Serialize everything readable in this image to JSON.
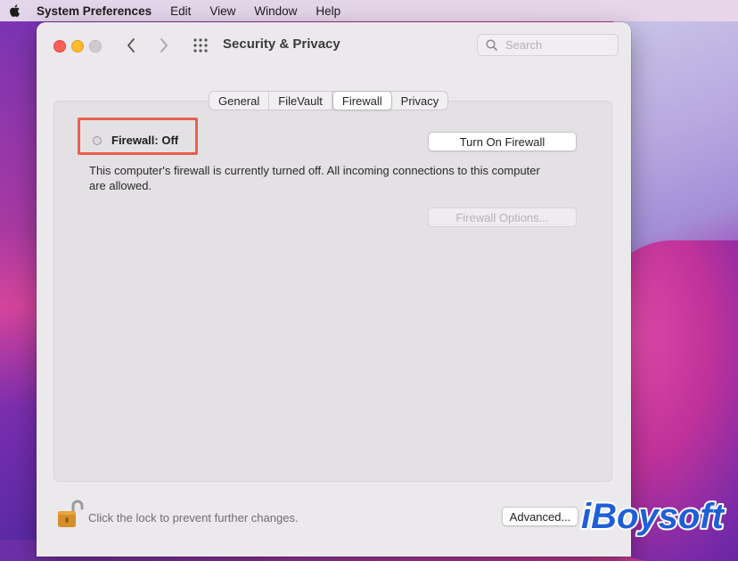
{
  "menubar": {
    "items": [
      "System Preferences",
      "Edit",
      "View",
      "Window",
      "Help"
    ]
  },
  "window": {
    "title": "Security & Privacy",
    "search_placeholder": "Search"
  },
  "tabs": [
    {
      "label": "General",
      "active": false
    },
    {
      "label": "FileVault",
      "active": false
    },
    {
      "label": "Firewall",
      "active": true
    },
    {
      "label": "Privacy",
      "active": false
    }
  ],
  "firewall": {
    "status_label": "Firewall: Off",
    "turn_on_label": "Turn On Firewall",
    "description": "This computer's firewall is currently turned off. All incoming connections to this computer are allowed.",
    "options_label": "Firewall Options..."
  },
  "footer": {
    "lock_text": "Click the lock to prevent further changes.",
    "advanced_label": "Advanced..."
  },
  "watermark": {
    "text": "iBoysoft"
  },
  "colors": {
    "highlight": "#e8604e",
    "watermark": "#1f5fd6"
  }
}
